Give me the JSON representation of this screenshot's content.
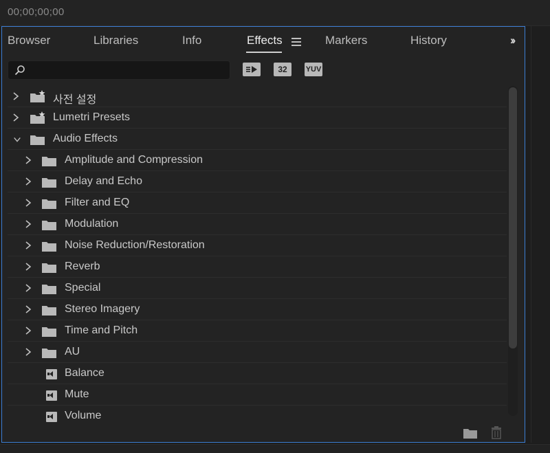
{
  "timecode": "00;00;00;00",
  "tabs": [
    {
      "label": "Browser",
      "active": false
    },
    {
      "label": "Libraries",
      "active": false
    },
    {
      "label": "Info",
      "active": false
    },
    {
      "label": "Effects",
      "active": true
    },
    {
      "label": "Markers",
      "active": false
    },
    {
      "label": "History",
      "active": false
    }
  ],
  "search": {
    "value": "",
    "placeholder": ""
  },
  "filters": [
    {
      "label": "",
      "icon": "accelerated-effects-icon"
    },
    {
      "label": "32",
      "icon": "32bit-color-icon"
    },
    {
      "label": "YUV",
      "icon": "yuv-effects-icon"
    }
  ],
  "tree": [
    {
      "label": "사전 설정",
      "level": 0,
      "type": "preset-folder",
      "expanded": false
    },
    {
      "label": "Lumetri Presets",
      "level": 0,
      "type": "preset-folder",
      "expanded": false
    },
    {
      "label": "Audio Effects",
      "level": 0,
      "type": "folder",
      "expanded": true
    },
    {
      "label": "Amplitude and Compression",
      "level": 1,
      "type": "folder",
      "expanded": false
    },
    {
      "label": "Delay and Echo",
      "level": 1,
      "type": "folder",
      "expanded": false
    },
    {
      "label": "Filter and EQ",
      "level": 1,
      "type": "folder",
      "expanded": false
    },
    {
      "label": "Modulation",
      "level": 1,
      "type": "folder",
      "expanded": false
    },
    {
      "label": "Noise Reduction/Restoration",
      "level": 1,
      "type": "folder",
      "expanded": false
    },
    {
      "label": "Reverb",
      "level": 1,
      "type": "folder",
      "expanded": false
    },
    {
      "label": "Special",
      "level": 1,
      "type": "folder",
      "expanded": false
    },
    {
      "label": "Stereo Imagery",
      "level": 1,
      "type": "folder",
      "expanded": false
    },
    {
      "label": "Time and Pitch",
      "level": 1,
      "type": "folder",
      "expanded": false
    },
    {
      "label": "AU",
      "level": 1,
      "type": "folder",
      "expanded": false
    },
    {
      "label": "Balance",
      "level": 1,
      "type": "effect"
    },
    {
      "label": "Mute",
      "level": 1,
      "type": "effect"
    },
    {
      "label": "Volume",
      "level": 1,
      "type": "effect"
    }
  ],
  "footer": {
    "new_bin_icon": "new-folder-icon",
    "delete_icon": "trash-icon"
  },
  "colors": {
    "accent": "#3c7fd6",
    "panel_bg": "#232323",
    "text": "#c9c9c9"
  }
}
